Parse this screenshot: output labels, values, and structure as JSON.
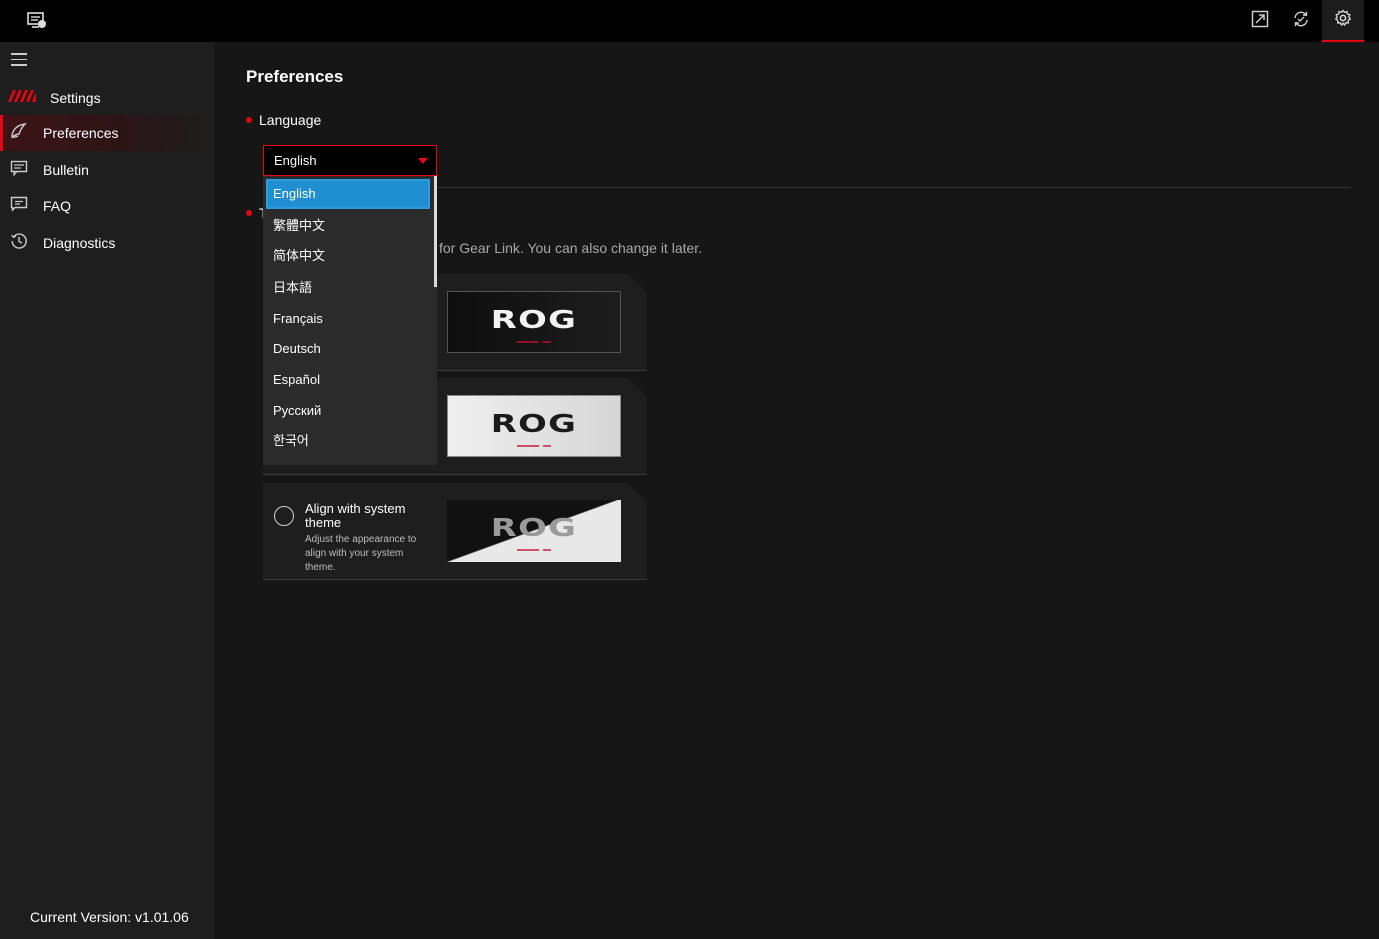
{
  "topbar": {
    "icons": [
      "app-monitor-icon",
      "expand-icon",
      "refresh-icon",
      "gear-icon"
    ],
    "accent_color": "#e30613"
  },
  "sidebar": {
    "header": "Settings",
    "items": [
      {
        "label": "Preferences",
        "icon": "palette-icon",
        "active": true
      },
      {
        "label": "Bulletin",
        "icon": "bulletin-icon",
        "active": false
      },
      {
        "label": "FAQ",
        "icon": "faq-icon",
        "active": false
      },
      {
        "label": "Diagnostics",
        "icon": "history-icon",
        "active": false
      }
    ],
    "version": "Current Version: v1.01.06"
  },
  "main": {
    "title": "Preferences",
    "language_section": "Language",
    "theme_section_partial": "T",
    "theme_description_partial": "for Gear Link. You can also change it later.",
    "language_select": {
      "value": "English",
      "options": [
        "English",
        "繁體中文",
        "简体中文",
        "日本語",
        "Français",
        "Deutsch",
        "Español",
        "Русский",
        "한국어"
      ],
      "highlighted_index": 0
    },
    "theme_options": [
      {
        "preview": "dark",
        "logo": "ROG"
      },
      {
        "preview": "light",
        "logo": "ROG"
      },
      {
        "title": "Align with system theme",
        "description": "Adjust the appearance to align with your system theme.",
        "preview": "mixed",
        "logo": "ROG",
        "selected": false
      }
    ]
  }
}
